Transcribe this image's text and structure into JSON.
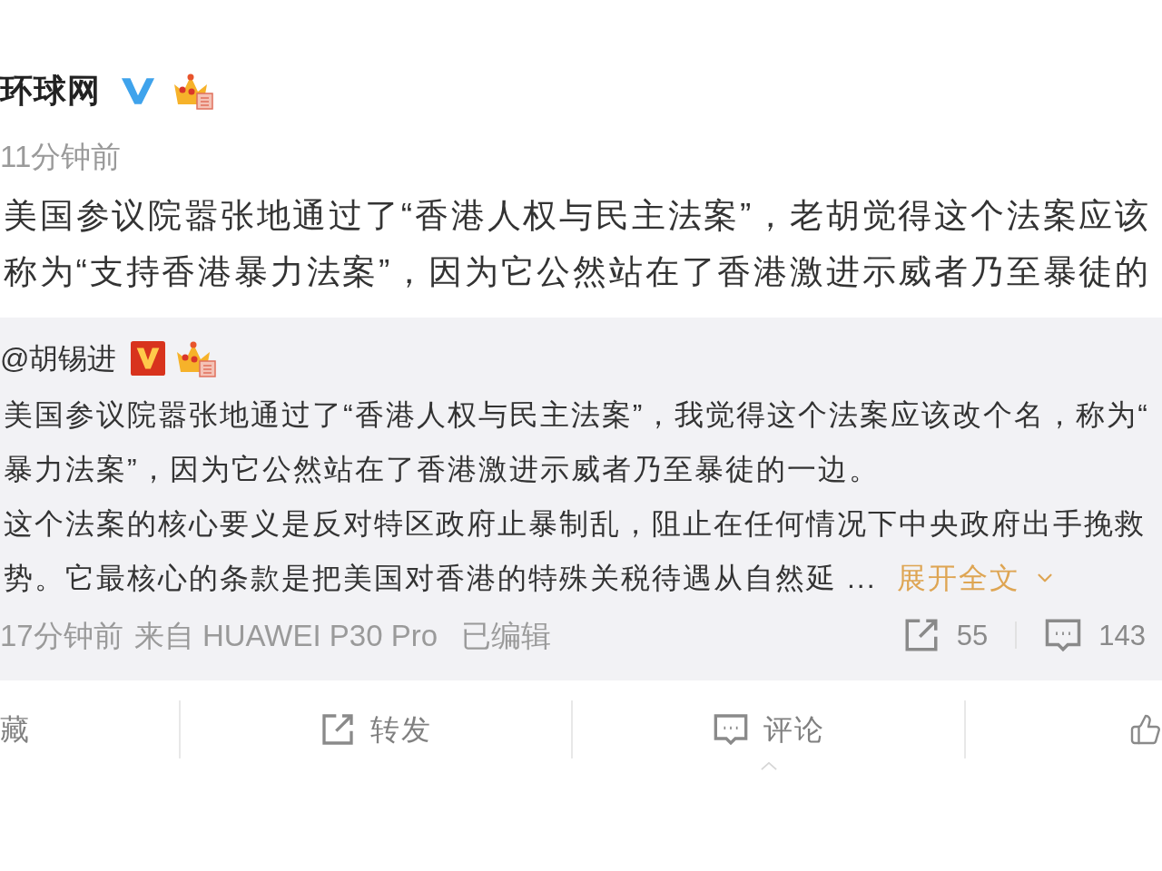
{
  "post": {
    "author": "环球网",
    "time": "11分钟前",
    "lines": [
      "美国参议院嚣张地通过了“香港人权与民主法案”，老胡觉得这个法案应该",
      "称为“支持香港暴力法案”，因为它公然站在了香港激进示威者乃至暴徒的"
    ]
  },
  "repost": {
    "author": "@胡锡进",
    "lines": [
      "美国参议院嚣张地通过了“香港人权与民主法案”，我觉得这个法案应该改个名，称为“",
      "暴力法案”，因为它公然站在了香港激进示威者乃至暴徒的一边。",
      "这个法案的核心要义是反对特区政府止暴制乱，阻止在任何情况下中央政府出手挽救",
      "势。它最核心的条款是把美国对香港的特殊关税待遇从自然延 ..."
    ],
    "expand_link": "展开全文",
    "time": "17分钟前",
    "source": "来自 HUAWEI P30 Pro",
    "edited": "已编辑",
    "stats": [
      {
        "kind": "repost",
        "count": "55"
      },
      {
        "kind": "comment",
        "count": "143"
      }
    ]
  },
  "actions": [
    {
      "kind": "favorite",
      "label": "藏",
      "selected": false
    },
    {
      "kind": "repost",
      "label": "转发",
      "selected": false
    },
    {
      "kind": "comment",
      "label": "评论",
      "selected": true
    },
    {
      "kind": "like",
      "selected": false
    }
  ]
}
